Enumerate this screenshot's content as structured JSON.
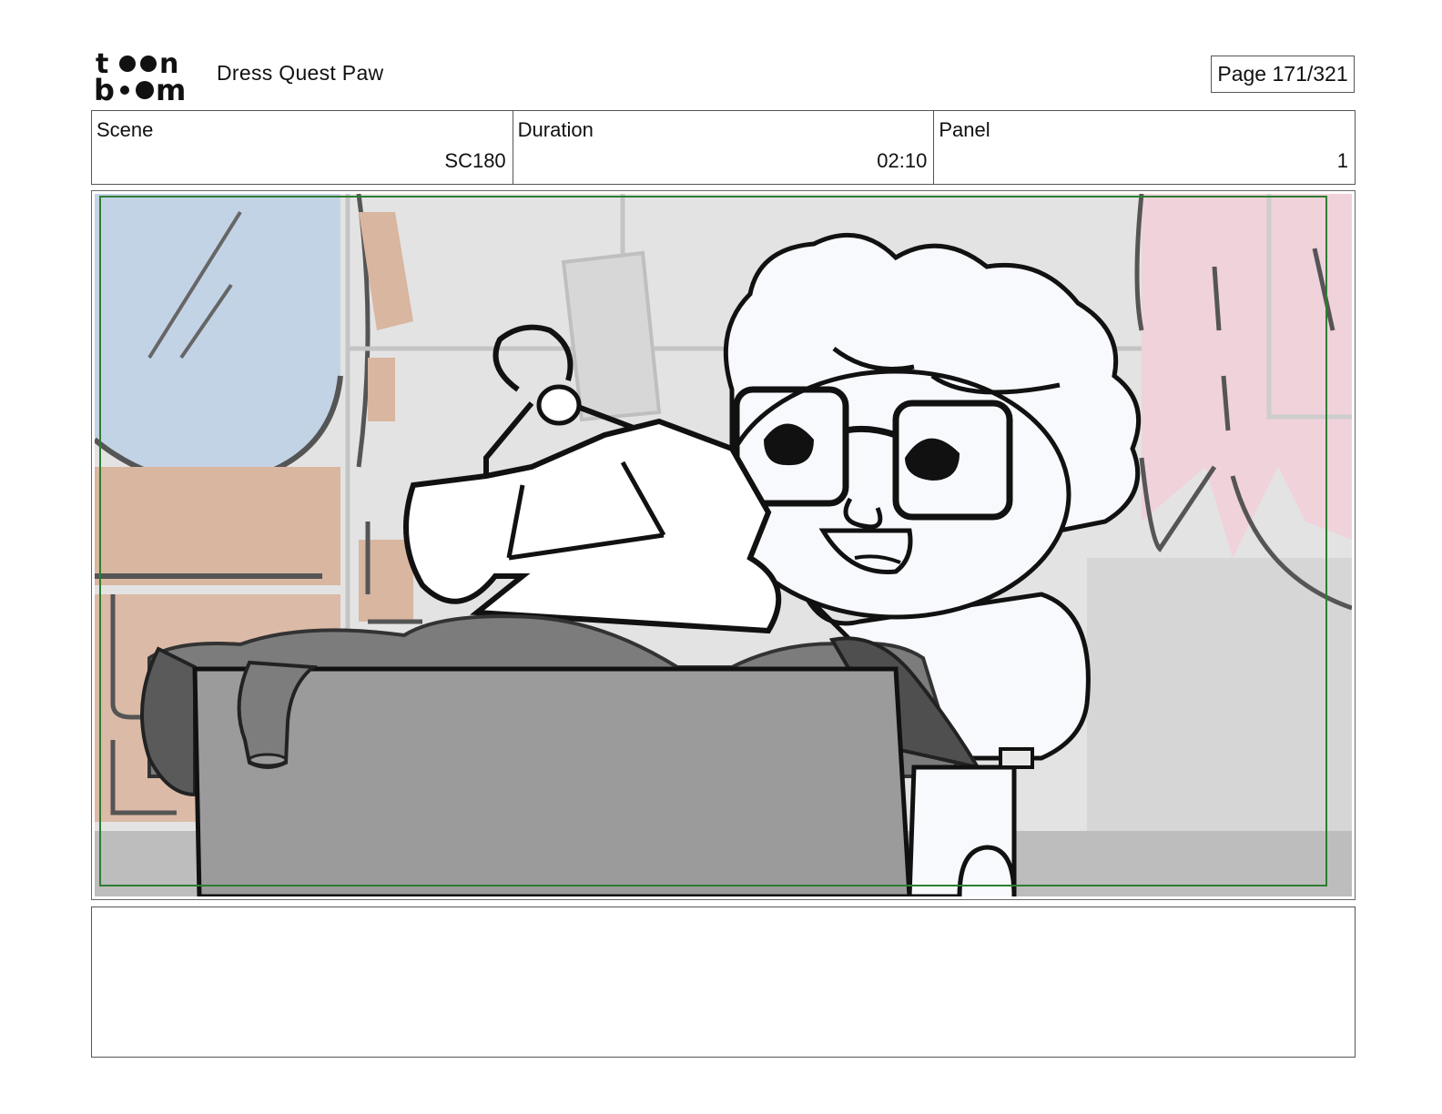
{
  "header": {
    "logo_text_top": "toon",
    "logo_text_bottom": "boom",
    "title": "Dress Quest Paw",
    "page_label": "Page 171/321"
  },
  "info": {
    "scene_label": "Scene",
    "scene_value": "SC180",
    "duration_label": "Duration",
    "duration_value": "02:10",
    "panel_label": "Panel",
    "panel_value": "1"
  },
  "panel": {
    "safe_area_color": "#2e7d32",
    "box_color": "#9b9b9b",
    "wall_color": "#e3e3e3",
    "curtain_blue": "#c3d3e6",
    "curtain_pink": "#f0d2da",
    "brick_tan": "#d9b6a0"
  },
  "notes": {
    "text": ""
  }
}
